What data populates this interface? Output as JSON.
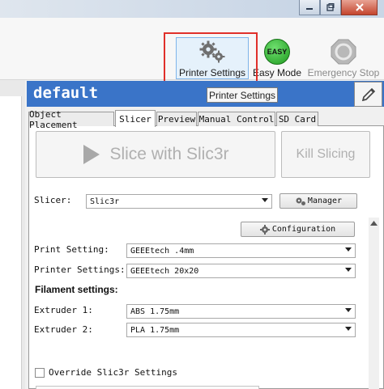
{
  "toolbar": {
    "printer_settings_label": "Printer Settings",
    "easy_mode_label": "Easy Mode",
    "easy_badge": "EASY",
    "emergency_stop_label": "Emergency Stop",
    "tooltip": "Printer Settings"
  },
  "header": {
    "title": "default"
  },
  "tabs": [
    "Object Placement",
    "Slicer",
    "Preview",
    "Manual Control",
    "SD Card"
  ],
  "slicer": {
    "slice_button": "Slice with Slic3r",
    "kill_button": "Kill Slicing",
    "slicer_label": "Slicer:",
    "slicer_value": "Slic3r",
    "manager_button": "Manager",
    "configuration_button": "Configuration",
    "print_setting_label": "Print Setting:",
    "print_setting_value": "GEEEtech .4mm",
    "printer_settings_label": "Printer Settings:",
    "printer_settings_value": "GEEEtech 20x20",
    "filament_heading": "Filament settings:",
    "extruder1_label": "Extruder 1:",
    "extruder1_value": "ABS 1.75mm",
    "extruder2_label": "Extruder 2:",
    "extruder2_value": "PLA 1.75mm",
    "override_label": "Override Slic3r Settings",
    "override_checked": false
  },
  "colors": {
    "header_bg": "#3a74c8",
    "highlight": "#e0302a",
    "easy_green": "#2fb52f"
  }
}
